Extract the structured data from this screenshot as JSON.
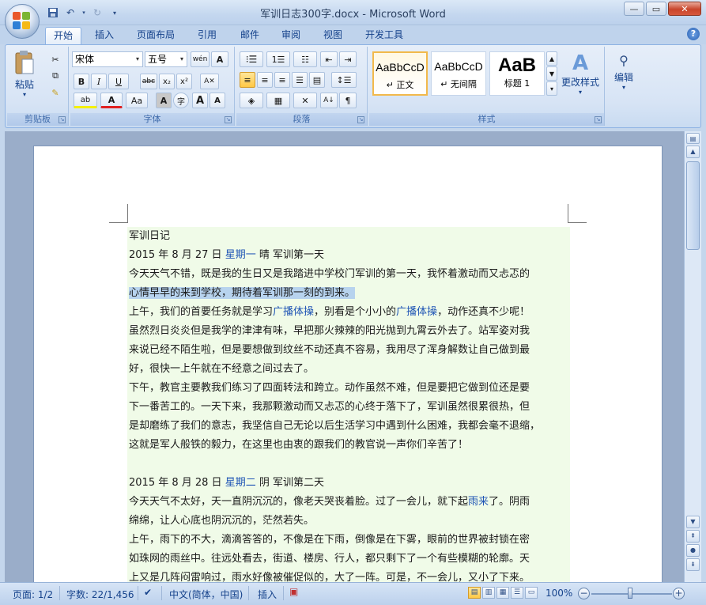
{
  "window": {
    "title": "军训日志300字.docx - Microsoft Word"
  },
  "tabs": [
    "开始",
    "插入",
    "页面布局",
    "引用",
    "邮件",
    "审阅",
    "视图",
    "开发工具"
  ],
  "ribbon": {
    "clipboard": {
      "label": "剪贴板",
      "paste": "粘贴"
    },
    "font": {
      "label": "字体",
      "font_name": "宋体",
      "font_size": "五号",
      "bold": "B",
      "italic": "I",
      "underline": "U",
      "strike": "abc",
      "subscript": "x₂",
      "superscript": "x²",
      "change_case": "Aa",
      "grow": "A",
      "shrink": "A"
    },
    "paragraph": {
      "label": "段落"
    },
    "styles": {
      "label": "样式",
      "items": [
        {
          "preview": "AaBbCcD",
          "name": "↵ 正文"
        },
        {
          "preview": "AaBbCcD",
          "name": "↵ 无间隔"
        },
        {
          "preview": "AaB",
          "name": "标题 1"
        }
      ],
      "change_styles": "更改样式"
    },
    "editing": {
      "label": "编辑"
    }
  },
  "document": {
    "paragraphs": [
      [
        {
          "t": "军训日记"
        }
      ],
      [
        {
          "t": "2015 年 8 月 27 日  "
        },
        {
          "t": "星期一",
          "blue": true
        },
        {
          "t": "   晴    军训第一天"
        }
      ],
      [
        {
          "t": "今天天气不错，既是我的生日又是我踏进中学校门军训的第一天，我怀着激动而又忐忑的"
        }
      ],
      [
        {
          "t": "心情早早的来到学校，期待着军训那一刻的到来。",
          "hl": true
        }
      ],
      [
        {
          "t": "上午，我们的首要任务就是学习"
        },
        {
          "t": "广播体操",
          "blue": true
        },
        {
          "t": "，别看是个小小的"
        },
        {
          "t": "广播体操",
          "blue": true
        },
        {
          "t": "，动作还真不少呢！"
        }
      ],
      [
        {
          "t": "虽然烈日炎炎但是我学的津津有味，早把那火辣辣的阳光抛到九霄云外去了。站军姿对我"
        }
      ],
      [
        {
          "t": "来说已经不陌生啦，但是要想做到纹丝不动还真不容易，我用尽了浑身解数让自己做到最"
        }
      ],
      [
        {
          "t": "好，很快一上午就在不经意之间过去了。"
        }
      ],
      [
        {
          "t": "下午，教官主要教我们练习了四面转法和跨立。动作虽然不难，但是要把它做到位还是要"
        }
      ],
      [
        {
          "t": "下一番苦工的。一天下来，我那颗激动而又忐忑的心终于落下了，军训虽然很累很热，但"
        }
      ],
      [
        {
          "t": "是却磨练了我们的意志，我坚信自己无论以后生活学习中遇到什么困难，我都会毫不退缩，"
        }
      ],
      [
        {
          "t": "这就是军人般铁的毅力，在这里也由衷的跟我们的教官说一声你们辛苦了！"
        }
      ],
      [],
      [
        {
          "t": "2015 年 8 月 28 日  "
        },
        {
          "t": "星期二",
          "blue": true
        },
        {
          "t": "   阴   军训第二天"
        }
      ],
      [
        {
          "t": "今天天气不太好，天一直阴沉沉的，像老天哭丧着脸。过了一会儿，就下起"
        },
        {
          "t": "雨来",
          "blue": true
        },
        {
          "t": "了。阴雨"
        }
      ],
      [
        {
          "t": "绵绵，让人心底也阴沉沉的，茫然若失。"
        }
      ],
      [
        {
          "t": "上午，雨下的不大，滴滴答答的，不像是在下雨，倒像是在下雾，眼前的世界被封锁在密"
        }
      ],
      [
        {
          "t": "如珠网的雨丝中。往远处看去，街道、楼房、行人，都只剩下了一个有些模糊的轮廓。天"
        }
      ],
      [
        {
          "t": "上又是几阵闷雷响过，雨水好像被催促似的，大了一阵。可是，不一会儿，又小了下来。"
        }
      ]
    ]
  },
  "statusbar": {
    "page": "页面: 1/2",
    "words": "字数: 22/1,456",
    "language": "中文(简体，中国)",
    "mode": "插入",
    "zoom": "100%",
    "zoom_level": 100
  }
}
